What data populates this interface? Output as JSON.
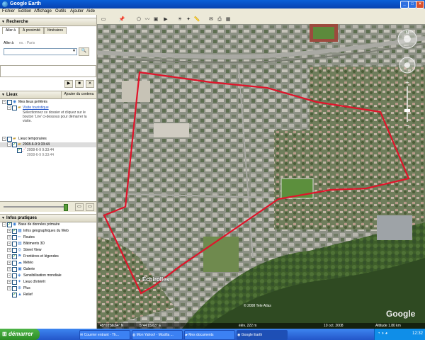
{
  "window": {
    "title": "Google Earth"
  },
  "menu": [
    "Fichier",
    "Edition",
    "Affichage",
    "Outils",
    "Ajouter",
    "Aide"
  ],
  "search": {
    "header": "Recherche",
    "tabs": [
      "Aller à",
      "À proximité",
      "Itinéraires"
    ],
    "label": "Aller à",
    "hint": "ex. : Paris"
  },
  "places": {
    "header": "Lieux",
    "add_content": "Ajouter du contenu",
    "items": [
      {
        "label": "Mes lieux préférés"
      },
      {
        "label": "Visite touristique"
      },
      {
        "label": "Sélectionnez ce dossier et cliquez sur le bouton 'Lire' ci-dessous pour démarrer la visite."
      },
      {
        "label": "Lieux temporaires"
      },
      {
        "label": "2008-6-9 9:33:44"
      },
      {
        "label": "2008-6-9 9:33:44"
      },
      {
        "label": "2008-6-9 9:33:44"
      }
    ]
  },
  "layers": {
    "header": "Infos pratiques",
    "items": [
      "Base de données primaire",
      "Infos géographiques du Web",
      "Routes",
      "Bâtiments 3D",
      "Street View",
      "Frontières et légendes",
      "Météo",
      "Galerie",
      "Sensibilisation mondiale",
      "Lieux d'intérêt",
      "Plus",
      "Relief"
    ],
    "checked": [
      true,
      true,
      false,
      false,
      false,
      true,
      false,
      false,
      false,
      false,
      false,
      true
    ]
  },
  "map": {
    "place_label": "Échirolles",
    "copyright": "© 2008 Tele Atlas",
    "logo": "Google",
    "route_color": "#e0142a"
  },
  "status": {
    "coords": "45°08'56.64\" N",
    "lon": "5°44'15.63\" E",
    "elev": "élév. 222 m",
    "date": "10 oct. 2008",
    "altitude": "Altitude 1.80 km"
  },
  "taskbar": {
    "start": "démarrer",
    "tasks": [
      "Courrier entrant - Th...",
      "Mon Yahoo! - Mozilla ...",
      "Mes documents",
      "Google Earth"
    ],
    "clock": "12:32"
  }
}
